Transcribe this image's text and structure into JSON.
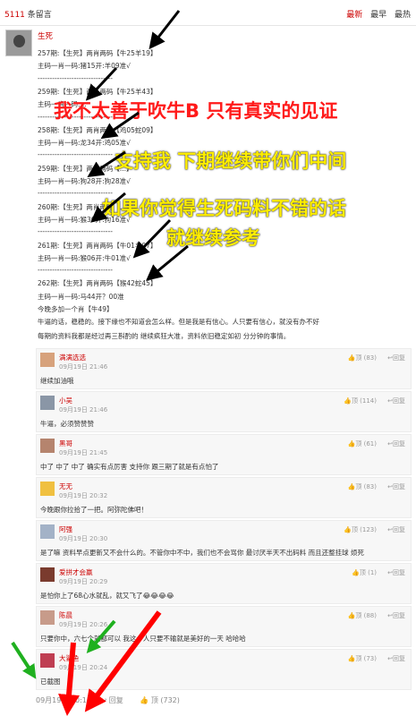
{
  "header": {
    "count_num": "5111",
    "count_label": "条留言",
    "sort_newest": "最新",
    "sort_earliest": "最早",
    "sort_hottest": "最热"
  },
  "post": {
    "author": "生死",
    "lines": [
      "257期:【生死】两肖两码【牛25羊19】",
      "主码一肖一码:猪15开:羊09准√",
      "-------------------------------",
      "259期:【生死】两肖两码【牛25羊43】",
      "主码一肖一码:...",
      "-------------------------------",
      "258期:【生死】两肖两码【鸡05蛇09】",
      "主码一肖一码:龙34开:鸡05准√",
      "-------------------------------",
      "259期:【生死】两肖两码【...】",
      "主码一肖一码:狗28开:狗28准√",
      "-------------------------------",
      "260期:【生死】两肖两码【...】",
      "主码一肖一码:猴30开:狗16准√",
      "-------------------------------",
      "261期:【生死】两肖两码【牛01羊07】",
      "主码一肖一码:猴06开:牛01准√",
      "-------------------------------",
      "262期:【生死】两肖两码【猴42蛇45】",
      "主码一肖一码:马44开？00准",
      "今晚多加一个肖【牛49】"
    ],
    "para1": "牛逼的话，稳稳的。接下缘也不知道会怎么样。但是我是有信心。人只要有信心，就没有办不好",
    "para2": "每期的资料我都是经过再三斟酌的 继续疯狂大准，资料依旧稳定如初 分分钟的事情。"
  },
  "overlays": {
    "line1": "我不太善于吹牛B 只有真实的见证",
    "line2": "支持我 下期继续带你们中间",
    "line3": "如果你觉得生死码料不错的话",
    "line4": "就继续参考"
  },
  "replies": [
    {
      "name": "满满选选",
      "time": "09月19日 21:46",
      "text": "继续加油哦",
      "vote": "顶 (83)",
      "reply": "回复"
    },
    {
      "name": "小吴",
      "time": "09月19日 21:46",
      "text": "牛逼，必须赞赞赞",
      "vote": "顶 (114)",
      "reply": "回复"
    },
    {
      "name": "黑哥",
      "time": "09月19日 21:45",
      "text": "中了 中了 中了 确实有点厉害 支持你 跟三期了就是有点怕了",
      "vote": "顶 (61)",
      "reply": "回复"
    },
    {
      "name": "无无",
      "time": "09月19日 20:32",
      "text": "今晚跟你拉拾了一把。阿弥陀佛吧！",
      "vote": "顶 (83)",
      "reply": "回复"
    },
    {
      "name": "阿强",
      "time": "09月19日 20:30",
      "text": "是了嘛 资料早点更新又不会什么的。不管你中不中，我们也不会骂你 最讨厌半天不出码料 而且还整挂球 烦死",
      "vote": "顶 (123)",
      "reply": "回复"
    },
    {
      "name": "爱拼才会赢",
      "time": "09月19日 20:29",
      "text": "是怕你上了68心水就乱，就又飞了😂😂😂😂",
      "vote": "顶 (1)",
      "reply": "回复"
    },
    {
      "name": "陈晨",
      "time": "09月19日 20:26",
      "text": "只要你中，六七个就都可以 我这个人只要不输就是美好的一天 哈哈哈",
      "vote": "顶 (88)",
      "reply": "回复"
    },
    {
      "name": "大鲨鱼",
      "time": "09月19日 20:24",
      "text": "已截图",
      "vote": "顶 (73)",
      "reply": "回复"
    }
  ],
  "footer": {
    "time": "09月19日 20:13",
    "reply": "回复",
    "vote": "顶 (732)"
  }
}
